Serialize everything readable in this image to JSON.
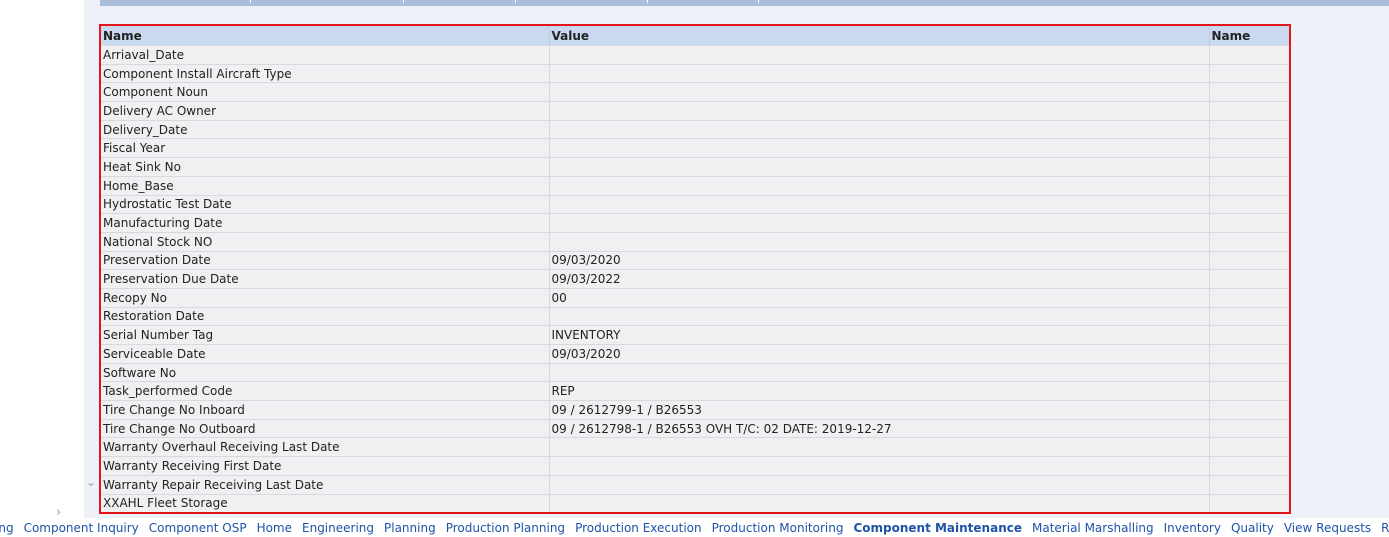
{
  "table": {
    "headers": [
      "Name",
      "Value",
      "Name"
    ],
    "rows": [
      {
        "name": "Arriaval_Date",
        "value": ""
      },
      {
        "name": "Component Install Aircraft Type",
        "value": ""
      },
      {
        "name": "Component Noun",
        "value": ""
      },
      {
        "name": "Delivery AC Owner",
        "value": ""
      },
      {
        "name": "Delivery_Date",
        "value": ""
      },
      {
        "name": "Fiscal Year",
        "value": ""
      },
      {
        "name": "Heat Sink No",
        "value": ""
      },
      {
        "name": "Home_Base",
        "value": ""
      },
      {
        "name": "Hydrostatic Test Date",
        "value": ""
      },
      {
        "name": "Manufacturing Date",
        "value": ""
      },
      {
        "name": "National Stock NO",
        "value": ""
      },
      {
        "name": "Preservation Date",
        "value": "09/03/2020"
      },
      {
        "name": "Preservation Due Date",
        "value": "09/03/2022"
      },
      {
        "name": "Recopy No",
        "value": "00"
      },
      {
        "name": "Restoration Date",
        "value": ""
      },
      {
        "name": "Serial Number Tag",
        "value": "INVENTORY"
      },
      {
        "name": "Serviceable Date",
        "value": "09/03/2020"
      },
      {
        "name": "Software No",
        "value": ""
      },
      {
        "name": "Task_performed Code",
        "value": "REP"
      },
      {
        "name": "Tire Change No Inboard",
        "value": "09 / 2612799-1 / B26553"
      },
      {
        "name": "Tire Change No Outboard",
        "value": "09 / 2612798-1 / B26553 OVH T/C: 02 DATE: 2019-12-27"
      },
      {
        "name": "Warranty Overhaul Receiving Last Date",
        "value": ""
      },
      {
        "name": "Warranty Receiving First Date",
        "value": ""
      },
      {
        "name": "Warranty Repair Receiving Last Date",
        "value": ""
      },
      {
        "name": "XXAHL Fleet Storage",
        "value": ""
      }
    ]
  },
  "bottom_nav": {
    "items": [
      {
        "label": "ing",
        "active": false
      },
      {
        "label": "Component Inquiry",
        "active": false
      },
      {
        "label": "Component OSP",
        "active": false
      },
      {
        "label": "Home",
        "active": false
      },
      {
        "label": "Engineering",
        "active": false
      },
      {
        "label": "Planning",
        "active": false
      },
      {
        "label": "Production Planning",
        "active": false
      },
      {
        "label": "Production Execution",
        "active": false
      },
      {
        "label": "Production Monitoring",
        "active": false
      },
      {
        "label": "Component Maintenance",
        "active": true
      },
      {
        "label": "Material Marshalling",
        "active": false
      },
      {
        "label": "Inventory",
        "active": false
      },
      {
        "label": "Quality",
        "active": false
      },
      {
        "label": "View Requests",
        "active": false
      },
      {
        "label": "Reports /",
        "active": false
      }
    ]
  },
  "icons": {
    "scroll_right": "chevron-right-icon",
    "scroll_down": "chevron-down-icon"
  },
  "colors": {
    "highlight_border": "#e2161b",
    "header_bg": "#c9daf0",
    "link": "#1f53a8"
  }
}
